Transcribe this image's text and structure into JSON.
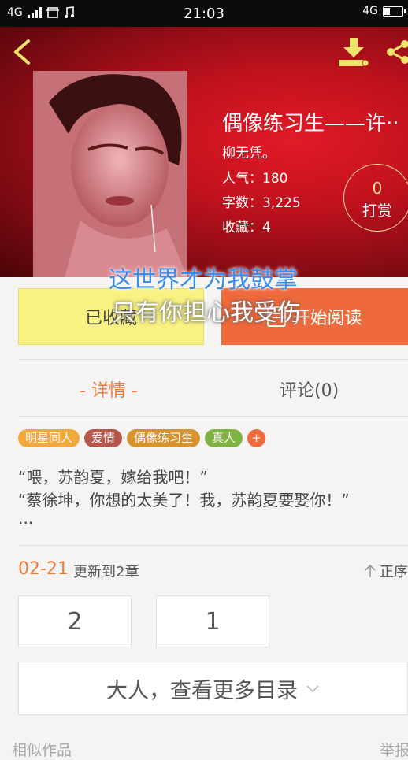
{
  "status_bar": {
    "network_left": "4G",
    "time": "21:03",
    "network_right": "4G"
  },
  "book": {
    "title": "偶像练习生——许··",
    "author": "柳无凭。",
    "popularity": "人气：180",
    "word_count": "字数：3,225",
    "favorites": "收藏：4",
    "tip_count": "0",
    "tip_label": "打赏"
  },
  "buttons": {
    "collected": "已收藏",
    "start_reading": "开始阅读"
  },
  "overlay": {
    "line1": "这世界才为我鼓掌",
    "line2": "只有你担心我受伤"
  },
  "tabs": {
    "details": "- 详情 -",
    "comments": "评论(0)"
  },
  "tags": [
    {
      "label": "明星同人",
      "color": "#f2a93b"
    },
    {
      "label": "爱情",
      "color": "#b5574a"
    },
    {
      "label": "偶像练习生",
      "color": "#d6932e"
    },
    {
      "label": "真人",
      "color": "#7fb243"
    },
    {
      "label": "+",
      "color": "#ee6a3c"
    }
  ],
  "description": {
    "line1": "“喂，苏韵夏，嫁给我吧！”",
    "line2": "“蔡徐坤，你想的太美了！我，苏韵夏要娶你！”",
    "line3": "···"
  },
  "update": {
    "date": "02-21",
    "text": "更新到2章",
    "sort_label": "正序"
  },
  "chapters": [
    "2",
    "1"
  ],
  "more_catalog": "大人，查看更多目录",
  "footer": {
    "similar": "相似作品",
    "report": "举报"
  },
  "colors": {
    "accent": "#ee6a3c",
    "collected_bg": "#f9f283",
    "header_red": "#c0121e"
  },
  "icons": [
    "back-arrow-icon",
    "download-icon",
    "share-icon",
    "book-icon",
    "sort-arrow-icon",
    "chevron-down-icon"
  ]
}
